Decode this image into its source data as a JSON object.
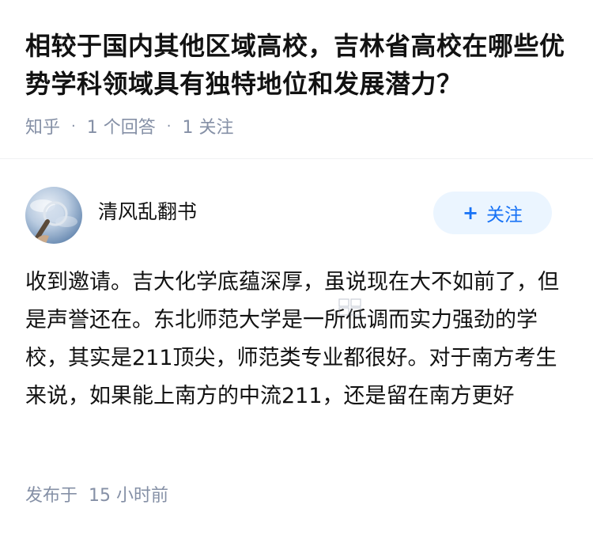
{
  "question": {
    "title": "相较于国内其他区域高校，吉林省高校在哪些优势学科领域具有独特地位和发展潜力？",
    "source": "知乎",
    "answers": "1 个回答",
    "followers": "1 关注"
  },
  "answer": {
    "author": {
      "name": "清风乱翻书",
      "follow_label": "关注",
      "follow_icon": "plus-icon"
    },
    "content": "收到邀请。吉大化学底蕴深厚，虽说现在大不如前了，但是声誉还在。东北师范大学是一所低调而实力强劲的学校，其实是211顶尖，师范类专业都很好。对于南方考生来说，如果能上南方的中流211，还是留在南方更好",
    "published_label": "发布于",
    "published_time": "15 小时前"
  },
  "colors": {
    "text": "#121212",
    "meta": "#8590a6",
    "accent": "#1772f6",
    "follow_bg": "#ebf5ff"
  }
}
